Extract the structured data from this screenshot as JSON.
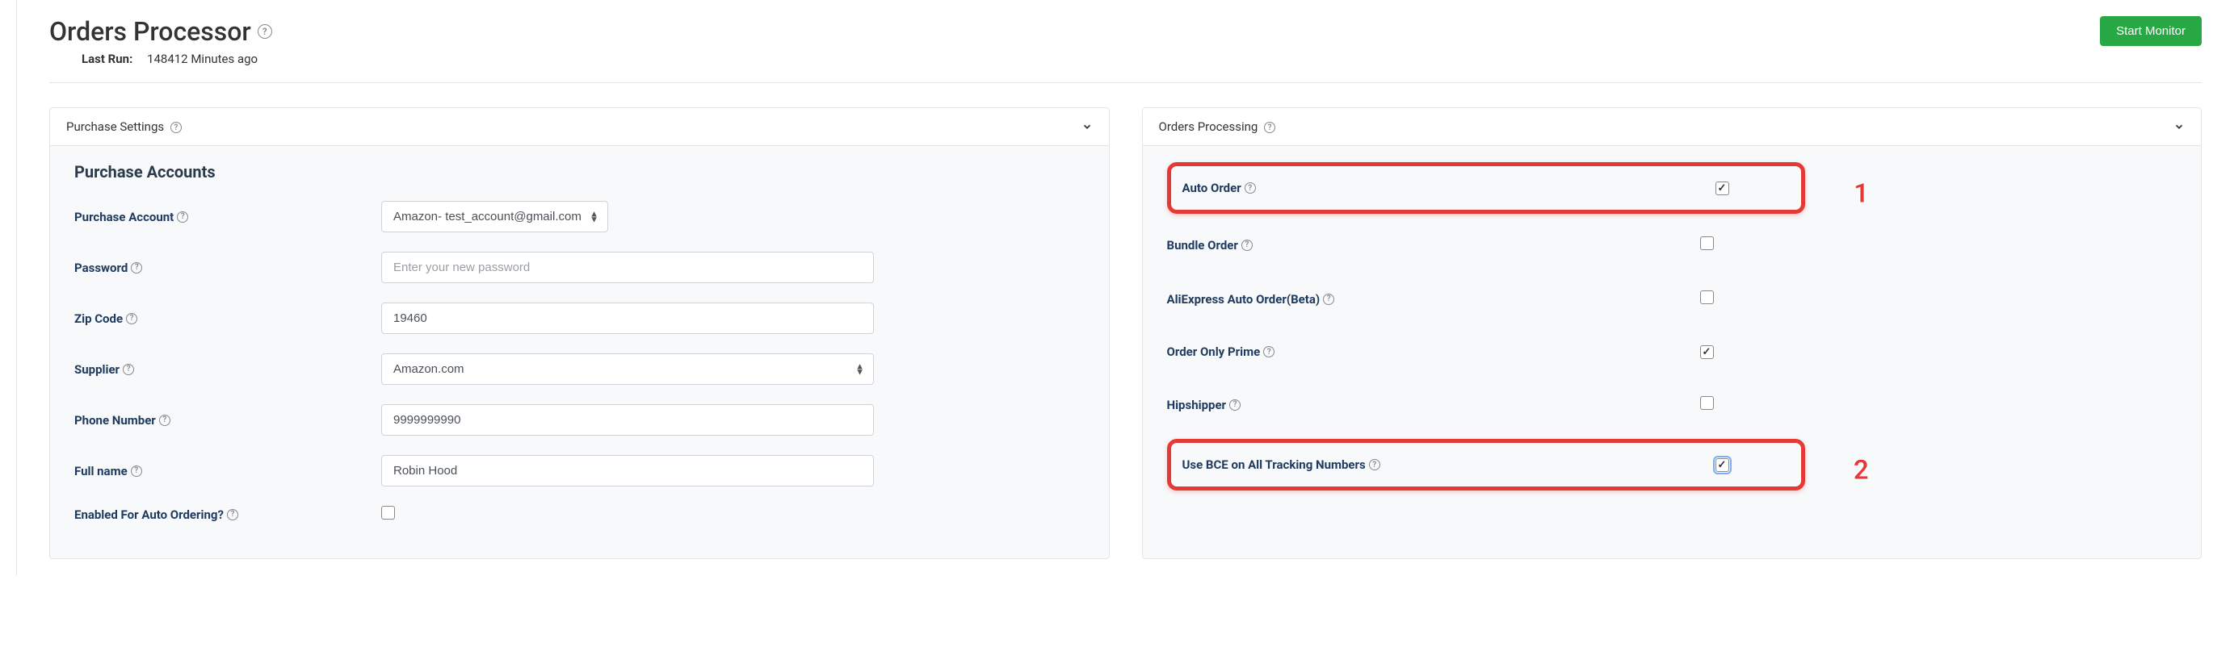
{
  "header": {
    "title": "Orders Processor",
    "last_run_label": "Last Run:",
    "last_run_value": "148412 Minutes ago",
    "start_monitor_label": "Start Monitor"
  },
  "left_panel": {
    "header": "Purchase Settings",
    "section_title": "Purchase Accounts",
    "purchase_account_label": "Purchase Account",
    "purchase_account_value": "Amazon- test_account@gmail.com",
    "password_label": "Password",
    "password_placeholder": "Enter your new password",
    "password_value": "",
    "zip_label": "Zip Code",
    "zip_value": "19460",
    "supplier_label": "Supplier",
    "supplier_value": "Amazon.com",
    "phone_label": "Phone Number",
    "phone_value": "9999999990",
    "fullname_label": "Full name",
    "fullname_value": "Robin Hood",
    "enabled_auto_label": "Enabled For Auto Ordering?",
    "enabled_auto_checked": false
  },
  "right_panel": {
    "header": "Orders Processing",
    "auto_order_label": "Auto Order",
    "auto_order_checked": true,
    "bundle_order_label": "Bundle Order",
    "bundle_order_checked": false,
    "aliexpress_label": "AliExpress Auto Order(Beta)",
    "aliexpress_checked": false,
    "order_prime_label": "Order Only Prime",
    "order_prime_checked": true,
    "hipshipper_label": "Hipshipper",
    "hipshipper_checked": false,
    "use_bce_label": "Use BCE on All Tracking Numbers",
    "use_bce_checked": true
  },
  "callouts": {
    "one": "1",
    "two": "2"
  }
}
